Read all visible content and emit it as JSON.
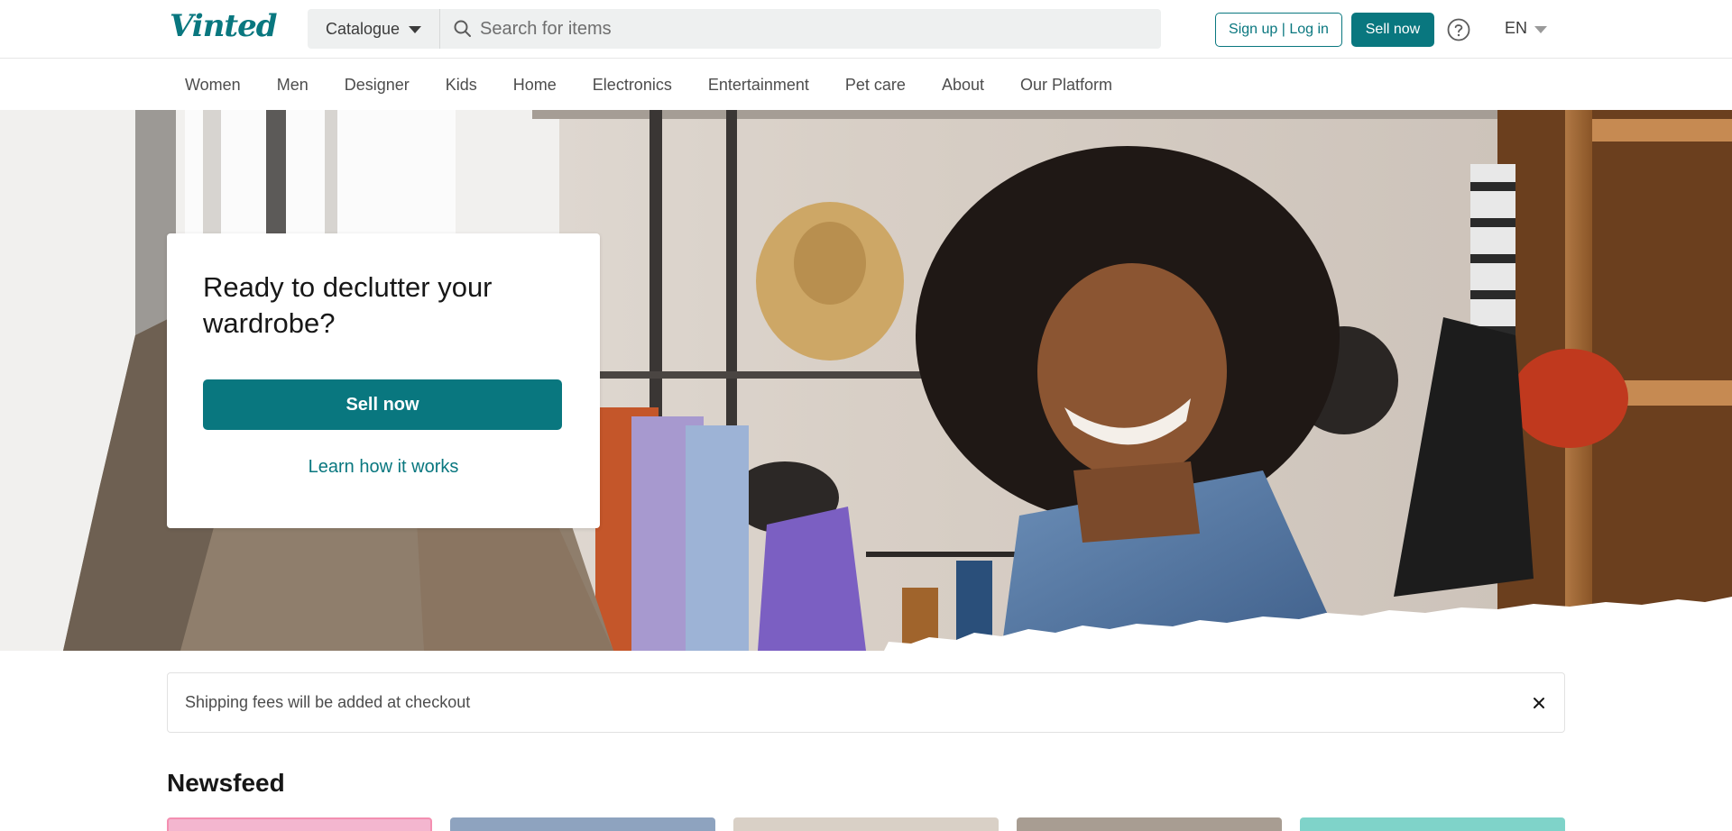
{
  "header": {
    "logo": "Vinted",
    "catalogue_label": "Catalogue",
    "search_placeholder": "Search for items",
    "signup_label": "Sign up | Log in",
    "sell_label": "Sell now",
    "language": "EN"
  },
  "nav": {
    "items": [
      "Women",
      "Men",
      "Designer",
      "Kids",
      "Home",
      "Electronics",
      "Entertainment",
      "Pet care",
      "About",
      "Our Platform"
    ]
  },
  "hero": {
    "title": "Ready to declutter your wardrobe?",
    "sell_button": "Sell now",
    "learn_link": "Learn how it works"
  },
  "notice": {
    "text": "Shipping fees will be added at checkout"
  },
  "newsfeed": {
    "title": "Newsfeed"
  },
  "colors": {
    "brand": "#09777f",
    "text": "#171717",
    "muted": "#4d4d4d"
  }
}
